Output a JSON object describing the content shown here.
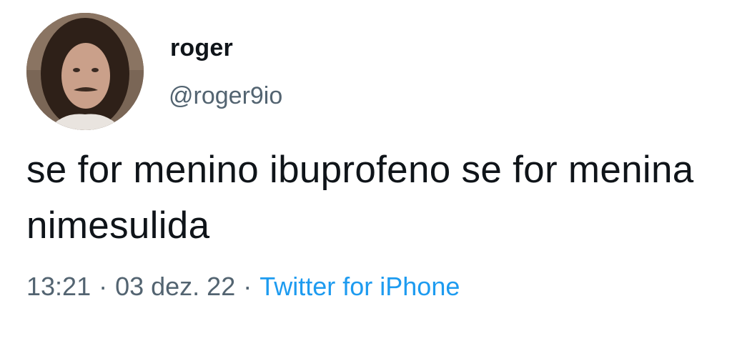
{
  "author": {
    "display_name": "roger",
    "handle": "@roger9io"
  },
  "tweet": {
    "text": "se for menino ibuprofeno se for menina nimesulida"
  },
  "meta": {
    "time": "13:21",
    "separator": "·",
    "date": "03 dez. 22",
    "source": "Twitter for iPhone"
  },
  "colors": {
    "link": "#1d9bf0",
    "secondary_text": "#536471",
    "primary_text": "#0f1419"
  }
}
